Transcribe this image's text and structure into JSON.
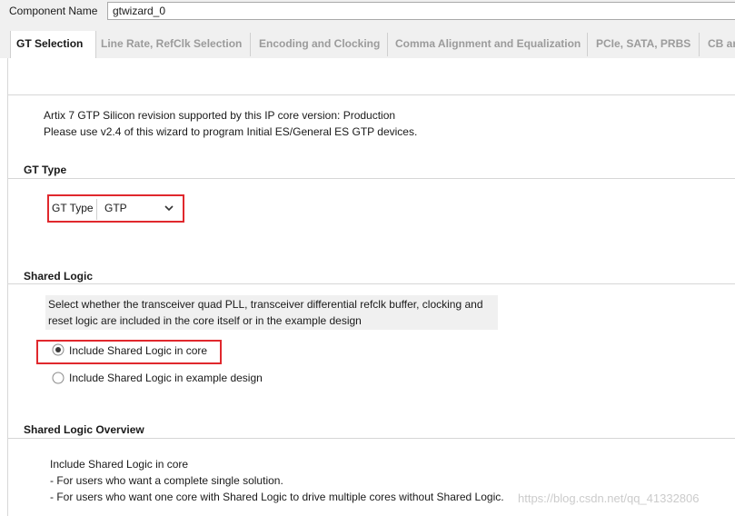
{
  "component": {
    "label": "Component Name",
    "value": "gtwizard_0"
  },
  "tabs": [
    {
      "label": "GT Selection",
      "active": true
    },
    {
      "label": "Line Rate, RefClk Selection",
      "active": false
    },
    {
      "label": "Encoding and Clocking",
      "active": false
    },
    {
      "label": "Comma Alignment and Equalization",
      "active": false
    },
    {
      "label": "PCIe, SATA, PRBS",
      "active": false
    },
    {
      "label": "CB ar",
      "active": false
    }
  ],
  "info": {
    "line1": "Artix 7 GTP Silicon revision supported by this IP core version: Production",
    "line2": "Please use v2.4 of this wizard to program Initial ES/General ES GTP devices."
  },
  "gt_type": {
    "section_title": "GT Type",
    "field_label": "GT Type",
    "selected": "GTP"
  },
  "shared_logic": {
    "section_title": "Shared Logic",
    "desc_line1": "Select whether the transceiver quad PLL, transceiver differential refclk buffer, clocking and",
    "desc_line2": "reset logic are included in the core itself or in the example design",
    "options": [
      {
        "label": "Include Shared Logic in core",
        "selected": true
      },
      {
        "label": "Include Shared Logic in example design",
        "selected": false
      }
    ]
  },
  "overview": {
    "section_title": "Shared Logic Overview",
    "line1": "Include Shared Logic in core",
    "line2": "- For users who want a complete single solution.",
    "line3": "- For users who want one core with Shared Logic to drive multiple cores without Shared Logic."
  },
  "watermark": "https://blog.csdn.net/qq_41332806",
  "colors": {
    "highlight": "#e0282d",
    "panel_bg": "#f0f0f0"
  },
  "icons": {
    "dropdown": "chevron-down-icon",
    "radio_on": "radio-selected-icon",
    "radio_off": "radio-unselected-icon"
  }
}
